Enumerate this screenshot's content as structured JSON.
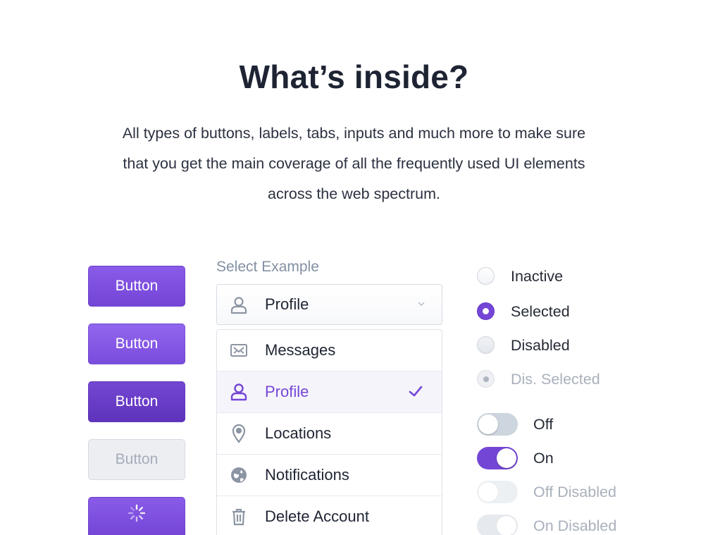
{
  "header": {
    "title": "What’s inside?",
    "description": "All types of buttons, labels, tabs, inputs and much more to make sure that you get the main coverage of all the frequently used UI elements across the web spectrum."
  },
  "buttons": [
    {
      "label": "Button",
      "state": "default"
    },
    {
      "label": "Button",
      "state": "hover"
    },
    {
      "label": "Button",
      "state": "pressed"
    },
    {
      "label": "Button",
      "state": "disabled"
    },
    {
      "label": "",
      "state": "loading",
      "icon": "spinner-icon"
    }
  ],
  "select": {
    "label": "Select Example",
    "value": "Profile",
    "value_icon": "user-icon",
    "options": [
      {
        "label": "Messages",
        "icon": "mail-icon",
        "selected": false
      },
      {
        "label": "Profile",
        "icon": "user-icon",
        "selected": true
      },
      {
        "label": "Locations",
        "icon": "map-pin-icon",
        "selected": false
      },
      {
        "label": "Notifications",
        "icon": "globe-icon",
        "selected": false
      },
      {
        "label": "Delete Account",
        "icon": "trash-icon",
        "selected": false
      }
    ]
  },
  "radios": [
    {
      "label": "Inactive",
      "state": "inactive"
    },
    {
      "label": "Selected",
      "state": "selected"
    },
    {
      "label": "Disabled",
      "state": "disabled"
    },
    {
      "label": "Dis. Selected",
      "state": "disabled-selected"
    }
  ],
  "toggles": [
    {
      "label": "Off",
      "on": false,
      "disabled": false
    },
    {
      "label": "On",
      "on": true,
      "disabled": false
    },
    {
      "label": "Off Disabled",
      "on": false,
      "disabled": true
    },
    {
      "label": "On Disabled",
      "on": true,
      "disabled": true
    }
  ],
  "colors": {
    "accent": "#7446d6",
    "text": "#1e2433",
    "muted": "#a9b0bb"
  }
}
